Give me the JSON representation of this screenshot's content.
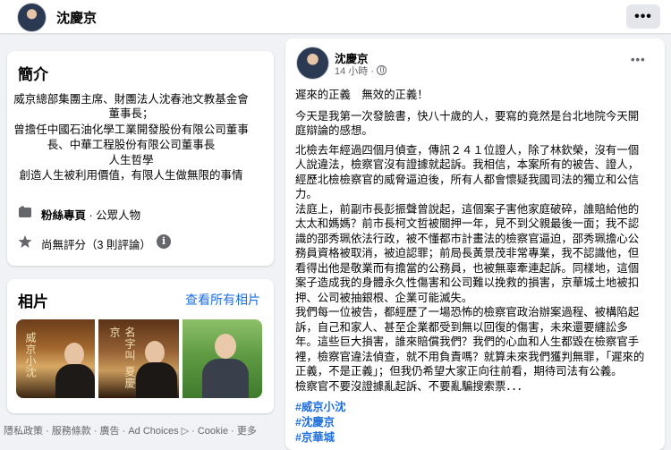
{
  "header": {
    "page_name": "沈慶京",
    "more_label": "•••"
  },
  "intro": {
    "title": "簡介",
    "lines": [
      "威京總部集團主席、財團法人沈春池文教基金會",
      "董事長；",
      "曾擔任中國石油化學工業開發股份有限公司董事",
      "長、中華工程股份有限公司董事長",
      "人生哲學",
      "創造人生被利用價值，有限人生做無限的事情"
    ],
    "category_bold": "粉絲專頁",
    "category_rest": " · 公眾人物",
    "rating": "尚無評分（3 則評論）",
    "info_icon": "i"
  },
  "photos": {
    "title": "相片",
    "see_all": "查看所有相片",
    "photo1_text": "威京小沈",
    "photo2_text": "名字叫 夏慶京"
  },
  "footer": {
    "text": "隱私政策 · 服務條款 · 廣告 · Ad Choices ▷ · Cookie · 更多"
  },
  "post": {
    "author": "沈慶京",
    "time": "14 小時 ·",
    "more_label": "•••",
    "lines": [
      "遲來的正義　無效的正義！",
      "今天是我第一次發臉書，快八十歲的人，要寫的竟然是台北地院今天開",
      "庭辯論的感想。",
      "北檢去年經過四個月偵查，傳訊２４１位證人，除了林欽榮，沒有一個",
      "人說違法，檢察官沒有證據就起訴。我相信，本案所有的被告、證人，",
      "經歷北檢檢察官的威脅逼迫後，所有人都會懷疑我國司法的獨立和公信",
      "力。",
      "法庭上，前副市長彭振聲曾說起，這個案子害他家庭破碎，誰賠給他的",
      "太太和媽媽？前市長柯文哲被關押一年，見不到父親最後一面；我不認",
      "識的邵秀珮依法行政，被不懂都市計畫法的檢察官逼迫，邵秀珮擔心公",
      "務員資格被取消，被迫認罪；前局長黃景茂非常專業，我不認識他，但",
      "看得出他是敬業而有擔當的公務員，也被無辜牽連起訴。同樣地，這個",
      "案子造成我的身體永久性傷害和公司難以挽救的損害，京華城土地被扣",
      "押、公司被抽銀根、企業可能滅失。",
      "我們每一位被告，都經歷了一場恐怖的檢察官政治辦案過程、被構陷起",
      "訴，自己和家人、甚至企業都受到無以回復的傷害，未來還要纏訟多",
      "年。這些巨大損害，誰來賠償我們？我們的心血和人生都毀在檢察官手",
      "裡，檢察官違法偵查，就不用負責嗎？就算未來我們獲判無罪，「遲來的",
      "正義，不是正義」；但我仍希望大家正向往前看，期待司法有公義。",
      "檢察官不要沒證據亂起訴、不要亂騙搜索票．．．"
    ],
    "hashtags": [
      "#威京小沈",
      "#沈慶京",
      "#京華城"
    ]
  }
}
